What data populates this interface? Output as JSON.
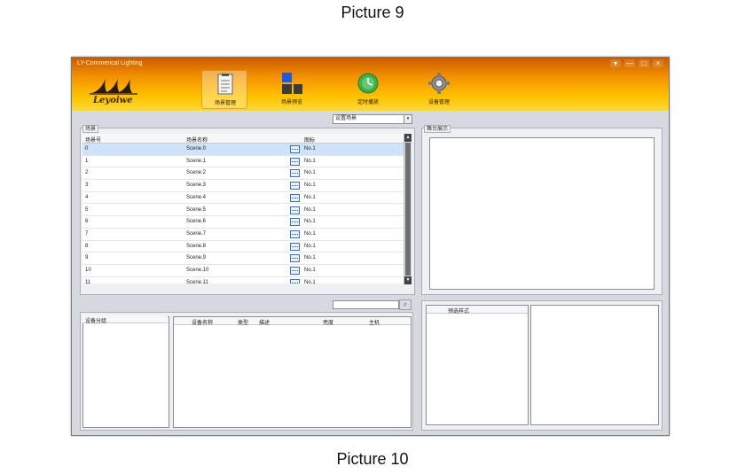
{
  "captions": {
    "top": "Picture 9",
    "bottom": "Picture 10"
  },
  "window": {
    "title": "LY-Commerical Lighting",
    "controls": [
      "▾",
      "—",
      "□",
      "×"
    ],
    "logo_text": "Leyoiwe"
  },
  "toolbar": {
    "items": [
      {
        "label": "场景管理",
        "icon": "document-icon"
      },
      {
        "label": "场景预览",
        "icon": "grid-icon"
      },
      {
        "label": "定时播放",
        "icon": "clock-icon"
      },
      {
        "label": "设备管理",
        "icon": "gear-icon"
      }
    ]
  },
  "scene_panel": {
    "group_label": "场景",
    "dropdown_value": "设置场景",
    "columns": [
      "场景号",
      "场景名称",
      "图标"
    ],
    "rows": [
      {
        "num": "0",
        "name": "Scene.0",
        "icon_label": "No.1"
      },
      {
        "num": "1",
        "name": "Scene.1",
        "icon_label": "No.1"
      },
      {
        "num": "2",
        "name": "Scene.2",
        "icon_label": "No.1"
      },
      {
        "num": "3",
        "name": "Scene.3",
        "icon_label": "No.1"
      },
      {
        "num": "4",
        "name": "Scene.4",
        "icon_label": "No.1"
      },
      {
        "num": "5",
        "name": "Scene.5",
        "icon_label": "No.1"
      },
      {
        "num": "6",
        "name": "Scene.6",
        "icon_label": "No.1"
      },
      {
        "num": "7",
        "name": "Scene.7",
        "icon_label": "No.1"
      },
      {
        "num": "8",
        "name": "Scene.8",
        "icon_label": "No.1"
      },
      {
        "num": "9",
        "name": "Scene.9",
        "icon_label": "No.1"
      },
      {
        "num": "10",
        "name": "Scene.10",
        "icon_label": "No.1"
      },
      {
        "num": "11",
        "name": "Scene.11",
        "icon_label": "No.1"
      }
    ]
  },
  "stage_panel": {
    "group_label": "舞台展示"
  },
  "device_panel": {
    "group_label": "设备分组",
    "columns": [
      "设备名称",
      "类型",
      "描述",
      "亮度",
      "主机"
    ]
  },
  "preset_panel": {
    "column": "预选样式"
  }
}
